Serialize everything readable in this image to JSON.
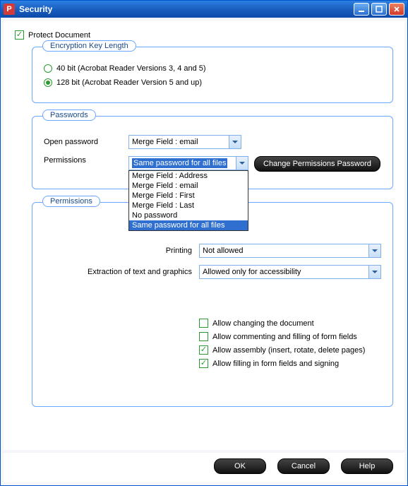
{
  "window": {
    "title": "Security",
    "app_glyph": "P"
  },
  "protect": {
    "label": "Protect Document",
    "checked": true
  },
  "encryption": {
    "legend": "Encryption Key Length",
    "opt40": "40 bit (Acrobat Reader Versions 3, 4 and 5)",
    "opt128": "128 bit (Acrobat Reader Version 5 and up)",
    "selected": "128"
  },
  "passwords": {
    "legend": "Passwords",
    "open_label": "Open password",
    "open_value": "Merge Field : email",
    "permissions_label": "Permissions",
    "permissions_value": "Same password for all files",
    "change_btn": "Change Permissions Password",
    "options": [
      "Merge Field : Address",
      "Merge Field : email",
      "Merge Field : First",
      "Merge Field : Last",
      "No password",
      "Same password for all files"
    ]
  },
  "permissions": {
    "legend": "Permissions",
    "printing_label": "Printing",
    "printing_value": "Not allowed",
    "extraction_label": "Extraction of text and graphics",
    "extraction_value": "Allowed only for accessibility",
    "checks": {
      "change_doc": {
        "label": "Allow changing the document",
        "checked": false
      },
      "comment_fill": {
        "label": "Allow commenting and filling of form fields",
        "checked": false
      },
      "assembly": {
        "label": "Allow assembly (insert, rotate, delete pages)",
        "checked": true
      },
      "fill_sign": {
        "label": "Allow filling in form fields and signing",
        "checked": true
      }
    }
  },
  "buttons": {
    "ok": "OK",
    "cancel": "Cancel",
    "help": "Help"
  }
}
